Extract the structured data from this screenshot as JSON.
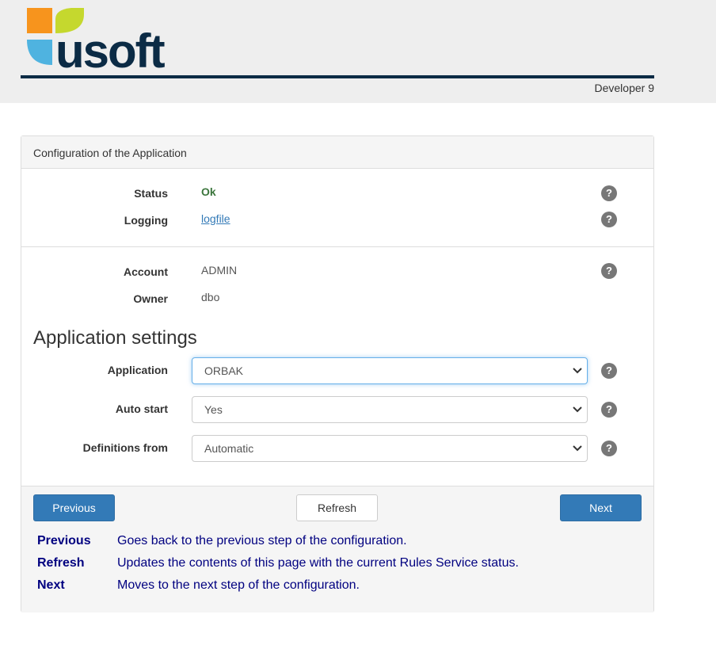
{
  "header": {
    "logo_text": "usoft",
    "version": "Developer 9",
    "colors": {
      "orange": "#F7941D",
      "green": "#C5D82E",
      "blue": "#4FB3E0",
      "navy": "#0B2B45"
    }
  },
  "panel": {
    "title": "Configuration of the Application",
    "status": {
      "label": "Status",
      "value": "Ok"
    },
    "logging": {
      "label": "Logging",
      "value": "logfile"
    },
    "account": {
      "label": "Account",
      "value": "ADMIN"
    },
    "owner": {
      "label": "Owner",
      "value": "dbo"
    },
    "help_glyph": "?"
  },
  "settings": {
    "title": "Application settings",
    "application": {
      "label": "Application",
      "value": "ORBAK"
    },
    "auto_start": {
      "label": "Auto start",
      "value": "Yes"
    },
    "definitions_from": {
      "label": "Definitions from",
      "value": "Automatic"
    }
  },
  "footer": {
    "previous_label": "Previous",
    "refresh_label": "Refresh",
    "next_label": "Next",
    "help": [
      {
        "key": "Previous",
        "desc": "Goes back to the previous step of the configuration."
      },
      {
        "key": "Refresh",
        "desc": "Updates the contents of this page with the current Rules Service status."
      },
      {
        "key": "Next",
        "desc": "Moves to the next step of the configuration."
      }
    ]
  }
}
